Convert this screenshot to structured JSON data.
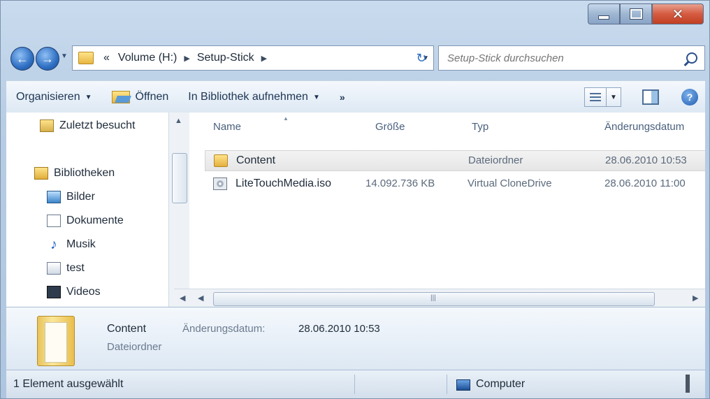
{
  "address": {
    "crumbs": [
      "Volume (H:)",
      "Setup-Stick"
    ],
    "overflow": "«"
  },
  "search": {
    "placeholder": "Setup-Stick durchsuchen"
  },
  "toolbar": {
    "organize": "Organisieren",
    "open": "Öffnen",
    "library": "In Bibliothek aufnehmen",
    "more": "»"
  },
  "nav": {
    "items": [
      {
        "label": "Zuletzt besucht",
        "icon": "recent-places-icon"
      },
      {
        "label": "Bibliotheken",
        "icon": "libraries-icon"
      },
      {
        "label": "Bilder",
        "icon": "pictures-icon"
      },
      {
        "label": "Dokumente",
        "icon": "documents-icon"
      },
      {
        "label": "Musik",
        "icon": "music-icon"
      },
      {
        "label": "test",
        "icon": "test-library-icon"
      },
      {
        "label": "Videos",
        "icon": "videos-icon"
      }
    ]
  },
  "files": {
    "columns": [
      "Name",
      "Größe",
      "Typ",
      "Änderungsdatum"
    ],
    "rows": [
      {
        "name": "Content",
        "size": "",
        "type": "Dateiordner",
        "modified": "28.06.2010 10:53",
        "selected": true,
        "icon": "folder-icon"
      },
      {
        "name": "LiteTouchMedia.iso",
        "size": "14.092.736 KB",
        "type": "Virtual CloneDrive",
        "modified": "28.06.2010 11:00",
        "selected": false,
        "icon": "iso-file-icon"
      }
    ]
  },
  "details": {
    "name": "Content",
    "type": "Dateiordner",
    "modified_label": "Änderungsdatum:",
    "modified_value": "28.06.2010 10:53"
  },
  "status": {
    "selection": "1 Element ausgewählt",
    "location": "Computer"
  }
}
